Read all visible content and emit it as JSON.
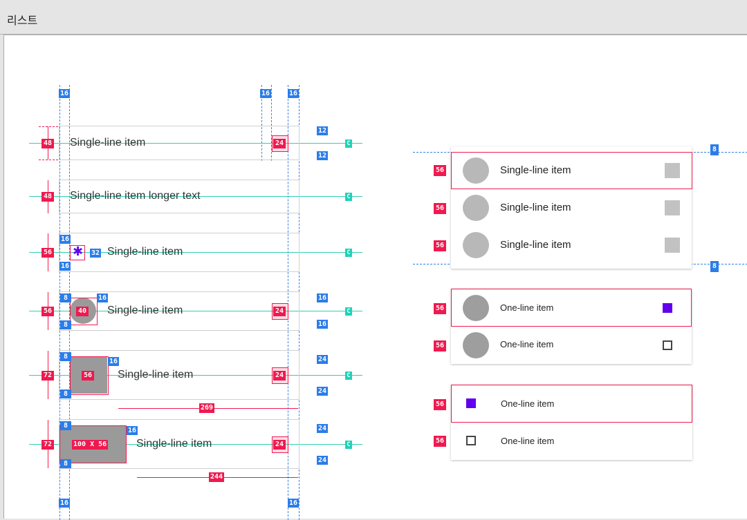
{
  "window": {
    "title": "리스트"
  },
  "left_spec": {
    "items": [
      {
        "label": "Single-line item",
        "height": "48",
        "right": "24",
        "top_gap": "12",
        "bottom_gap": "12",
        "center": "C"
      },
      {
        "label": "Single-line item longer text",
        "height": "48",
        "center": "C"
      },
      {
        "label": "Single-line item",
        "height": "56",
        "top_gap": "16",
        "bottom_gap": "16",
        "icon_gap": "32",
        "icon": "bluetooth-icon",
        "center": "C"
      },
      {
        "label": "Single-line item",
        "height": "56",
        "top_gap": "8",
        "bottom_gap": "8",
        "avatar_gap": "16",
        "avatar": "40",
        "right": "24",
        "right_top": "16",
        "right_bottom": "16",
        "center": "C"
      },
      {
        "label": "Single-line item",
        "height": "72",
        "top_gap": "8",
        "bottom_gap": "8",
        "image_gap": "16",
        "image": "56",
        "right": "24",
        "right_top": "24",
        "right_bottom": "24",
        "width": "269",
        "center": "C"
      },
      {
        "label": "Single-line item",
        "height": "72",
        "top_gap": "8",
        "bottom_gap": "8",
        "image_gap": "16",
        "image": "100 X 56",
        "right": "24",
        "right_top": "24",
        "right_bottom": "24",
        "width": "244",
        "center": "C"
      }
    ],
    "margin_top_left": "16",
    "margin_top_right_a": "16",
    "margin_top_right_b": "16",
    "margin_bottom_left": "16",
    "margin_bottom_right": "16"
  },
  "right_spec": {
    "group1": {
      "top_pad": "8",
      "bottom_pad": "8",
      "rows": [
        {
          "label": "Single-line item",
          "height": "56"
        },
        {
          "label": "Single-line item",
          "height": "56"
        },
        {
          "label": "Single-line item",
          "height": "56"
        }
      ]
    },
    "group2": {
      "rows": [
        {
          "label": "One-line item",
          "height": "56",
          "checked": true
        },
        {
          "label": "One-line item",
          "height": "56",
          "checked": false
        }
      ]
    },
    "group3": {
      "rows": [
        {
          "label": "One-line item",
          "height": "56",
          "checked": true
        },
        {
          "label": "One-line item",
          "height": "56",
          "checked": false
        }
      ]
    }
  },
  "colors": {
    "accent": "#6200ee",
    "spec_red": "#f0194f",
    "spec_blue": "#2b7de9",
    "spec_teal": "#1ed3b8"
  }
}
